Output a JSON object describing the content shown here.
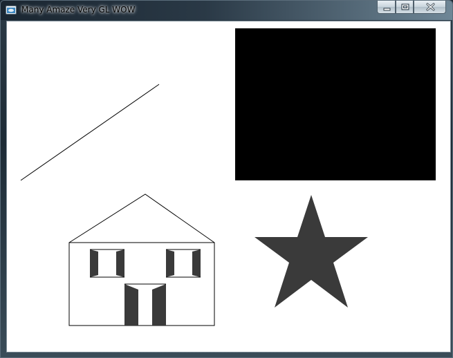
{
  "window": {
    "title": "Many Amaze Very GL WOW",
    "app_icon": "opengl-window-icon",
    "controls": {
      "minimize_icon": "minimize-icon",
      "maximize_icon": "maximize-icon",
      "close_icon": "close-icon"
    }
  },
  "scene": {
    "background_color": "#ffffff",
    "shapes": [
      "line",
      "filled-rectangle",
      "house",
      "star"
    ],
    "line_color": "#000000",
    "rectangle_fill": "#000000",
    "star_fill": "#3a3a3a",
    "house_outline_color": "#000000",
    "house_shutter_fill": "#3a3a3a"
  }
}
